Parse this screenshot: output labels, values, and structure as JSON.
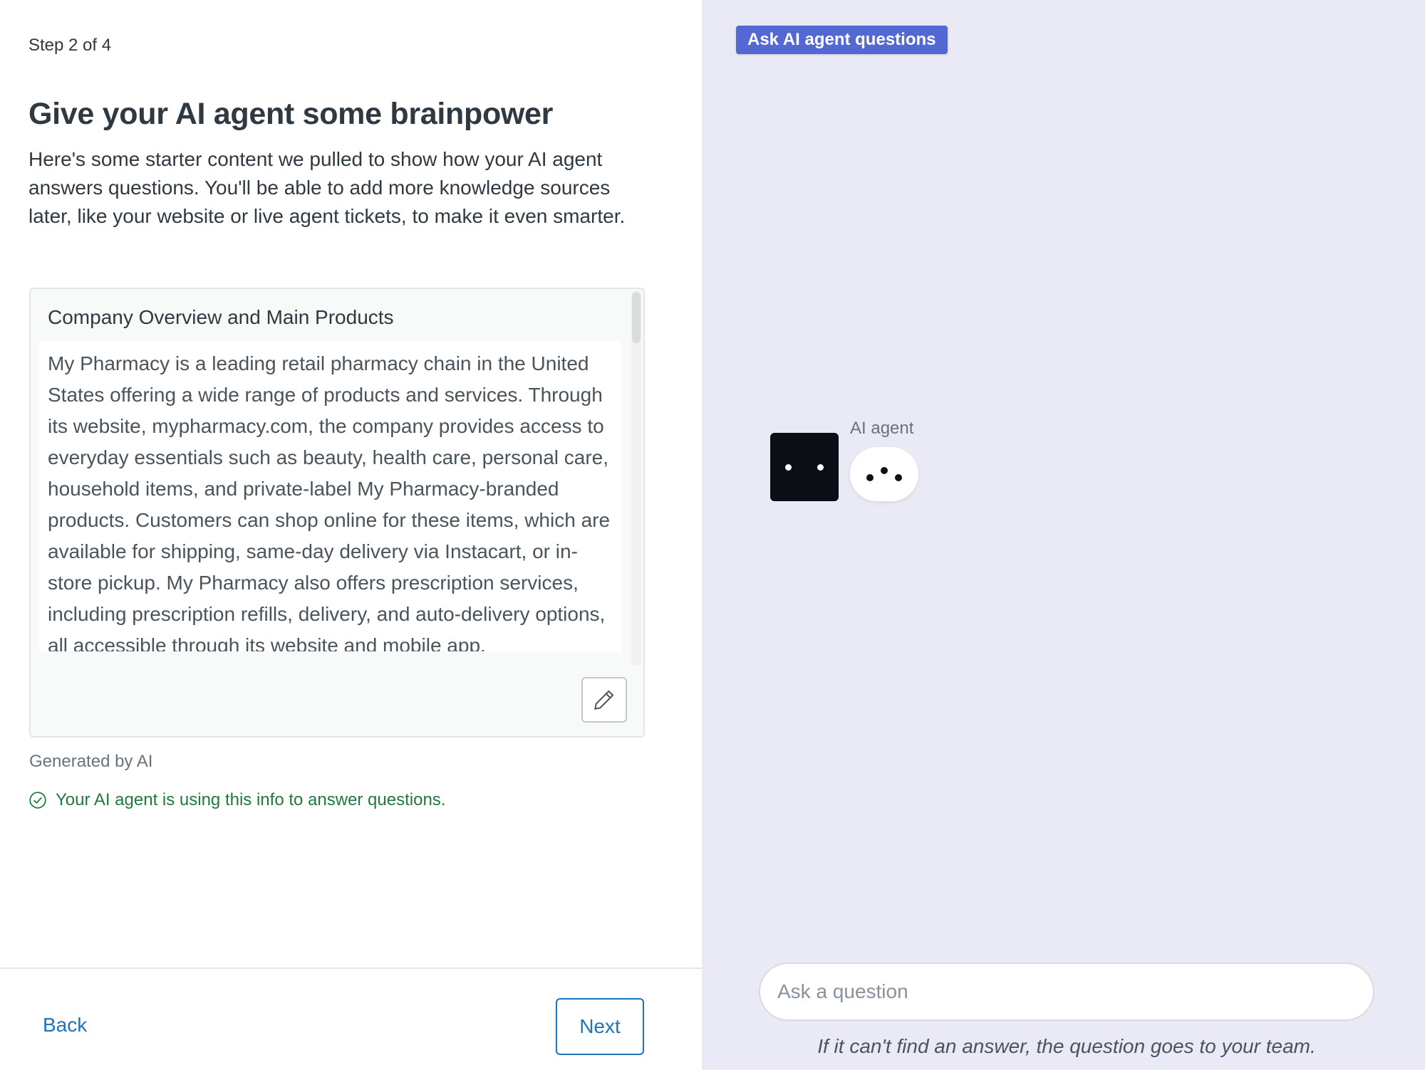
{
  "left_panel": {
    "step": "Step 2 of 4",
    "title": "Give your AI agent some brainpower",
    "intro": "Here's some starter content we pulled to show how your AI agent answers questions. You'll be able to add more knowledge sources later, like your website or live agent tickets, to make it even smarter.",
    "card": {
      "title": "Company Overview and Main Products",
      "body": "My Pharmacy is a leading retail pharmacy chain in the United States offering a wide range of products and services. Through its website, mypharmacy.com, the company provides access to everyday essentials such as beauty, health care, personal care, household items, and private-label My Pharmacy-branded products. Customers can shop online for these items, which are available for shipping, same-day delivery via Instacart, or in-store pickup. My Pharmacy also offers prescription services, including prescription refills, delivery, and auto-delivery options, all accessible through its website and mobile app.",
      "edit_icon": "pencil-icon"
    },
    "generated_label": "Generated by AI",
    "status_text": "Your AI agent is using this info to answer questions.",
    "status_icon": "check-circle-icon",
    "back_label": "Back",
    "next_label": "Next"
  },
  "right_panel": {
    "badge": "Ask AI agent questions",
    "agent_name": "AI agent",
    "input_placeholder": "Ask a question",
    "hint": "If it can't find an answer, the question goes to your team."
  },
  "colors": {
    "accent_blue": "#1f73b7",
    "badge_bg": "#5468d4",
    "right_bg": "#e9eaf6",
    "success_green": "#1f7a3d"
  }
}
